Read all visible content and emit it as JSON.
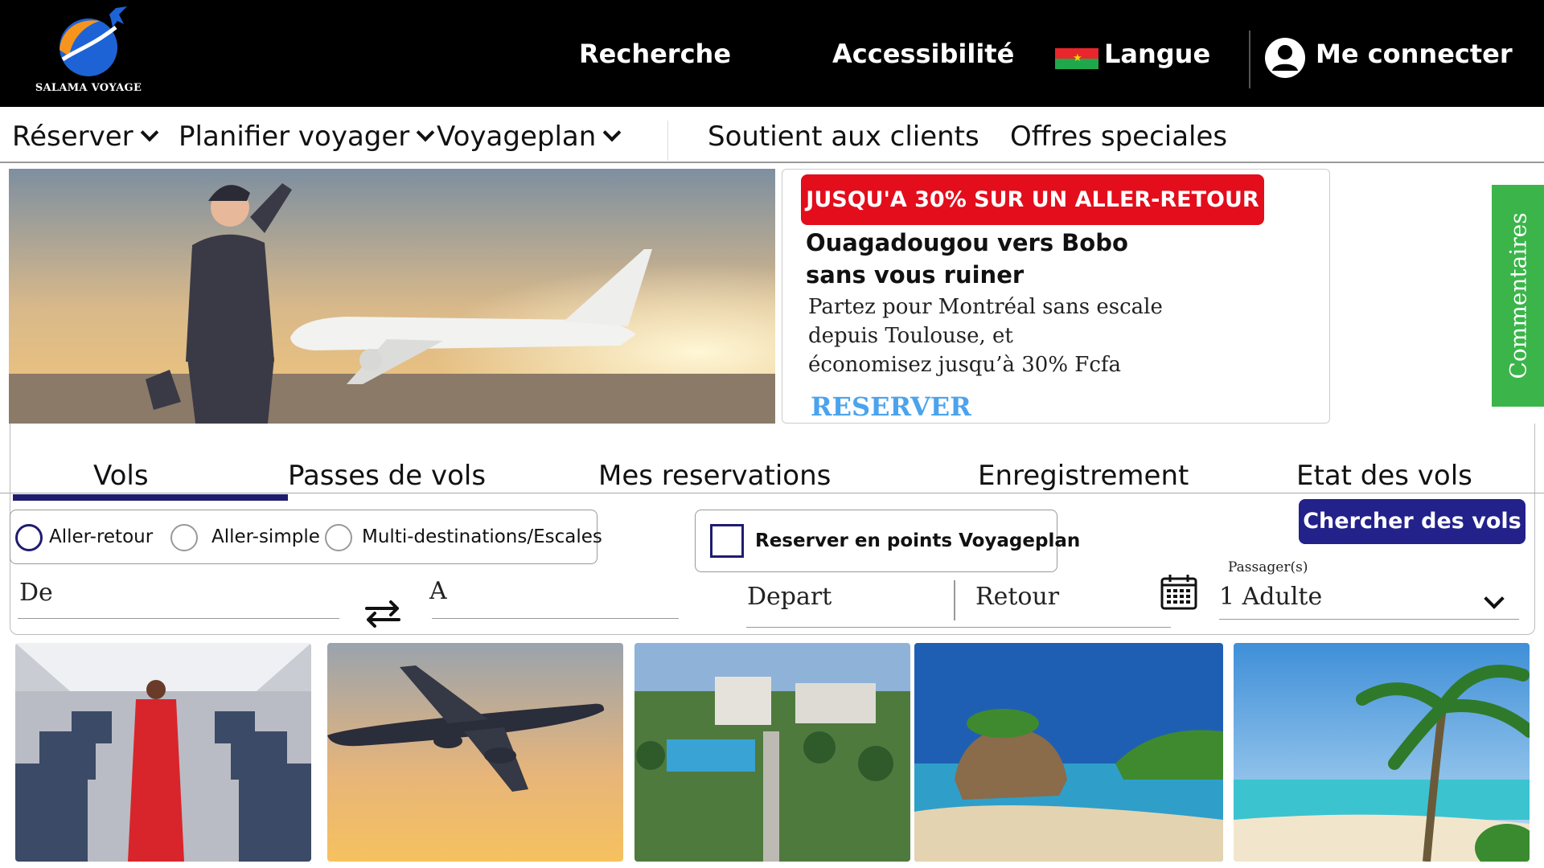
{
  "brand": {
    "name": "SALAMA VOYAGE"
  },
  "topbar": {
    "links": [
      "Recherche",
      "Accessibilité",
      "Langue"
    ],
    "login": "Me connecter",
    "icons": [
      "plane-logo-icon",
      "flag-icon",
      "user-icon"
    ]
  },
  "subnav": {
    "items": [
      "Réserver",
      "Planifier voyager",
      "Voyageplan",
      "Soutient aux clients",
      "Offres speciales"
    ]
  },
  "promo": {
    "badge": "JUSQU'A 30% SUR UN ALLER-RETOUR",
    "title_line1": "Ouagadougou vers Bobo",
    "title_line2": "sans vous ruiner",
    "text_line1": "Partez pour Montréal sans escale",
    "text_line2": "depuis Toulouse, et",
    "text_line3": "économisez jusqu’à 30% Fcfa",
    "cta": "RESERVER"
  },
  "feedback": {
    "label": "Commentaires"
  },
  "tabs": {
    "items": [
      "Vols",
      "Passes de vols",
      "Mes reservations",
      "Enregistrement",
      "Etat des vols"
    ],
    "active": "Vols"
  },
  "booking": {
    "trip_types": [
      "Aller-retour",
      "Aller-simple",
      "Multi-destinations/Escales"
    ],
    "selected_trip": "Aller-retour",
    "points_label": "Reserver en points Voyageplan",
    "search_button": "Chercher des vols",
    "from_label": "De",
    "to_label": "A",
    "depart_label": "Depart",
    "return_label": "Retour",
    "passengers_label": "Passager(s)",
    "passengers_value": "1 Adulte"
  },
  "colors": {
    "header_bg": "#000000",
    "accent_navy": "#23218a",
    "promo_red": "#e30d1c",
    "feedback_green": "#3bb54a",
    "cta_blue": "#4ba3ee"
  }
}
